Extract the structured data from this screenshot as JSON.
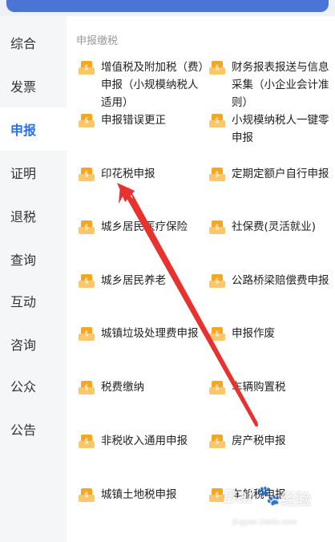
{
  "sidebar": {
    "items": [
      {
        "label": "综合"
      },
      {
        "label": "发票"
      },
      {
        "label": "申报"
      },
      {
        "label": "证明"
      },
      {
        "label": "退税"
      },
      {
        "label": "查询"
      },
      {
        "label": "互动"
      },
      {
        "label": "咨询"
      },
      {
        "label": "公众"
      },
      {
        "label": "公告"
      }
    ],
    "active_index": 2
  },
  "main": {
    "section_title": "申报缴税",
    "items": [
      {
        "label": "增值税及附加税（费）申报（小规模纳税人适用）"
      },
      {
        "label": "财务报表报送与信息采集（小企业会计准则）"
      },
      {
        "label": "申报错误更正"
      },
      {
        "label": "小规模纳税人一键零申报"
      },
      {
        "label": "印花税申报"
      },
      {
        "label": "定期定额户自行申报"
      },
      {
        "label": "城乡居民医疗保险"
      },
      {
        "label": "社保费(灵活就业)"
      },
      {
        "label": "城乡居民养老"
      },
      {
        "label": "公路桥梁赔偿费申报"
      },
      {
        "label": "城镇垃圾处理费申报"
      },
      {
        "label": "申报作废"
      },
      {
        "label": "税费缴纳"
      },
      {
        "label": "车辆购置税"
      },
      {
        "label": "非税收入通用申报"
      },
      {
        "label": "房产税申报"
      },
      {
        "label": "城镇土地税申报"
      },
      {
        "label": "车船税申报"
      }
    ]
  },
  "watermark": {
    "brand": "Bai",
    "brand_suffix": "经验",
    "url": "jingyan.baidu.com"
  },
  "colors": {
    "accent": "#2f6fea",
    "icon": "#f5a623",
    "arrow": "#e8322f"
  }
}
